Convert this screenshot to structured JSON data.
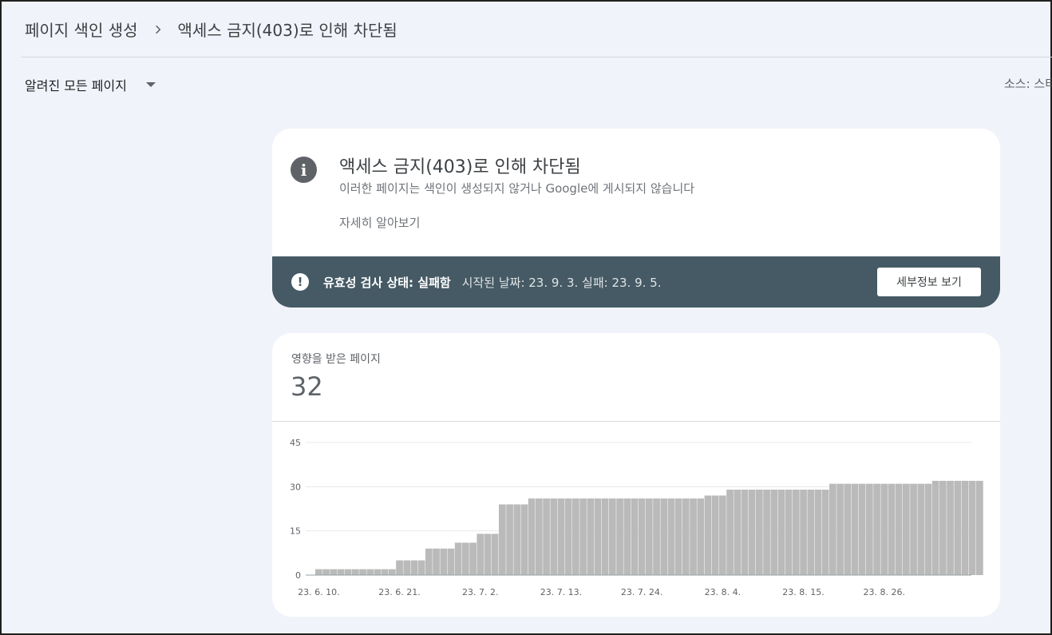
{
  "breadcrumb": {
    "parent": "페이지 색인 생성",
    "current": "액세스 금지(403)로 인해 차단됨"
  },
  "filter": {
    "label": "알려진 모든 페이지"
  },
  "source": {
    "label": "소스: 스터"
  },
  "issue_card": {
    "title": "액세스 금지(403)로 인해 차단됨",
    "description": "이러한 페이지는 색인이 생성되지 않거나 Google에 게시되지 않습니다",
    "learn_more": "자세히 알아보기",
    "validation_label": "유효성 검사 상태: 실패함",
    "validation_dates": "시작된 날짜: 23. 9. 3.   실패: 23. 9. 5.",
    "details_button": "세부정보 보기"
  },
  "affected_card": {
    "label": "영향을 받은 페이지",
    "value": "32"
  },
  "chart_data": {
    "type": "bar",
    "ylim": [
      0,
      45
    ],
    "yticks": [
      0,
      15,
      30,
      45
    ],
    "xtick_labels": [
      "23. 6. 10.",
      "23. 6. 21.",
      "23. 7. 2.",
      "23. 7. 13.",
      "23. 7. 24.",
      "23. 8. 4.",
      "23. 8. 15.",
      "23. 8. 26."
    ],
    "xtick_index": [
      0,
      11,
      22,
      33,
      44,
      55,
      66,
      77
    ],
    "bar_color": "#bababa",
    "grid": true,
    "values": [
      2,
      2,
      2,
      2,
      2,
      2,
      2,
      2,
      2,
      2,
      2,
      5,
      5,
      5,
      5,
      9,
      9,
      9,
      9,
      11,
      11,
      11,
      14,
      14,
      14,
      24,
      24,
      24,
      24,
      26,
      26,
      26,
      26,
      26,
      26,
      26,
      26,
      26,
      26,
      26,
      26,
      26,
      26,
      26,
      26,
      26,
      26,
      26,
      26,
      26,
      26,
      26,
      26,
      27,
      27,
      27,
      29,
      29,
      29,
      29,
      29,
      29,
      29,
      29,
      29,
      29,
      29,
      29,
      29,
      29,
      31,
      31,
      31,
      31,
      31,
      31,
      31,
      31,
      31,
      31,
      31,
      31,
      31,
      31,
      32,
      32,
      32,
      32,
      32,
      32,
      32
    ]
  }
}
